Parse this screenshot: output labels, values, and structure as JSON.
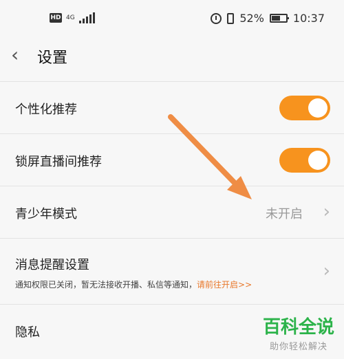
{
  "status_bar": {
    "hd_label": "HD",
    "network_label": "4G",
    "battery_percent": "52%",
    "time": "10:37"
  },
  "header": {
    "title": "设置"
  },
  "settings": {
    "personalized": {
      "label": "个性化推荐",
      "enabled": true
    },
    "lockscreen": {
      "label": "锁屏直播间推荐",
      "enabled": true
    },
    "youth": {
      "label": "青少年模式",
      "value": "未开启"
    },
    "notify": {
      "label": "消息提醒设置",
      "note": "通知权限已关闭，暂无法接收开播、私信等通知，",
      "link": "请前往开启>>"
    },
    "privacy": {
      "label": "隐私"
    }
  },
  "watermark": {
    "title": "百科全说",
    "subtitle": "助你轻松解决"
  },
  "colors": {
    "accent": "#f7931e",
    "link": "#e8772a",
    "watermark_green": "#2cb34a",
    "annotation_arrow": "#ef8d45"
  },
  "icons": [
    "hd-icon",
    "signal-icon",
    "alarm-icon",
    "vibrate-icon",
    "battery-icon",
    "back-icon",
    "chevron-right-icon"
  ]
}
